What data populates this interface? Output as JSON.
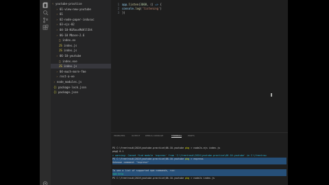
{
  "explorer": {
    "items": [
      {
        "label": "youtube-practice",
        "kind": "folder-open"
      },
      {
        "label": "01-view-new-youtube",
        "kind": "folder"
      },
      {
        "label": "01",
        "kind": "folder"
      },
      {
        "label": "02-node-paper-indusuc",
        "kind": "folder"
      },
      {
        "label": "03-ejs-02",
        "kind": "folder"
      },
      {
        "label": "04-10-NiRousMdAllSht",
        "kind": "folder"
      },
      {
        "label": "06-10 Mbase-2.6",
        "kind": "folder"
      },
      {
        "label": "index.ex",
        "kind": "file"
      },
      {
        "label": "index.js",
        "kind": "js"
      },
      {
        "label": "index.js",
        "kind": "js"
      },
      {
        "label": "06-10-youtube",
        "kind": "folder"
      },
      {
        "label": "index.exe",
        "kind": "file"
      },
      {
        "label": "index.js",
        "kind": "js"
      },
      {
        "label": "04-much-more-fme",
        "kind": "folder"
      },
      {
        "label": "rest-a-ee",
        "kind": "folder"
      },
      {
        "label": "node_modules.js",
        "kind": "folder"
      },
      {
        "label": "package-lock.json",
        "kind": "pkg"
      },
      {
        "label": "package.json",
        "kind": "pkg"
      }
    ]
  },
  "editor": {
    "lines": [
      {
        "n": "1",
        "parts": [
          {
            "t": "app",
            "c": "tk-var"
          },
          {
            "t": ".",
            "c": "tk-pun"
          },
          {
            "t": "listen",
            "c": "tk-fn"
          },
          {
            "t": "(",
            "c": "tk-pun"
          },
          {
            "t": "3000",
            "c": "tk-num"
          },
          {
            "t": ", () ",
            "c": "tk-pun"
          },
          {
            "t": "=>",
            "c": "tk-kw"
          },
          {
            "t": " {",
            "c": "tk-pun"
          }
        ]
      },
      {
        "n": "2",
        "parts": [
          {
            "t": "  console",
            "c": "tk-var"
          },
          {
            "t": ".",
            "c": "tk-pun"
          },
          {
            "t": "log",
            "c": "tk-fn"
          },
          {
            "t": "(",
            "c": "tk-pun"
          },
          {
            "t": "'listening'",
            "c": "tk-str"
          },
          {
            "t": ")",
            "c": "tk-pun"
          }
        ]
      },
      {
        "n": "3",
        "parts": [
          {
            "t": "})",
            "c": "tk-pun"
          }
        ]
      }
    ]
  },
  "panel": {
    "tabs": [
      "Problems",
      "Output",
      "Debug Console",
      "Terminal",
      "Ports"
    ],
    "active_tab": "Terminal"
  },
  "terminal": {
    "lines": [
      {
        "parts": [
          {
            "t": "PS C:\\freetrouk\\2024\\youtube-practice\\06-10-youtube ",
            "c": ""
          },
          {
            "t": "pkg",
            "c": "t-yel"
          },
          {
            "t": " > nodeJs-ejs index.js",
            "c": ""
          }
        ]
      },
      {
        "parts": [
          {
            "t": "pkg@ 0.1",
            "c": ""
          }
        ]
      },
      {
        "parts": [
          {
            "t": "> warning: Cannot find module 'express' from 'C:\\freetrouk\\2024\\youtube-practice\\06-10-youtube' in C:\\freetrou",
            "c": "t-cyn"
          }
        ]
      },
      {
        "hl": true,
        "parts": [
          {
            "t": "PS C:\\freetrouk\\2024\\youtube-practice\\06-10-youtube ",
            "c": ""
          },
          {
            "t": "pkg",
            "c": "t-yel"
          },
          {
            "t": " > express",
            "c": ""
          }
        ]
      },
      {
        "hl": true,
        "parts": [
          {
            "t": "Unknown command: \"express\"",
            "c": ""
          }
        ]
      },
      {
        "parts": [
          {
            "t": "",
            "c": ""
          }
        ]
      },
      {
        "hl": true,
        "parts": [
          {
            "t": "To see a list of supported npm commands, run:",
            "c": ""
          }
        ]
      },
      {
        "hl": true,
        "parts": [
          {
            "t": "  npm help",
            "c": "t-grn"
          }
        ]
      },
      {
        "parts": [
          {
            "t": "PS C:\\freetrouk\\2024\\youtube-practice\\06-10-youtube ",
            "c": ""
          },
          {
            "t": "pkg",
            "c": "t-yel"
          },
          {
            "t": " > nodeJs index.js",
            "c": ""
          }
        ]
      }
    ]
  }
}
